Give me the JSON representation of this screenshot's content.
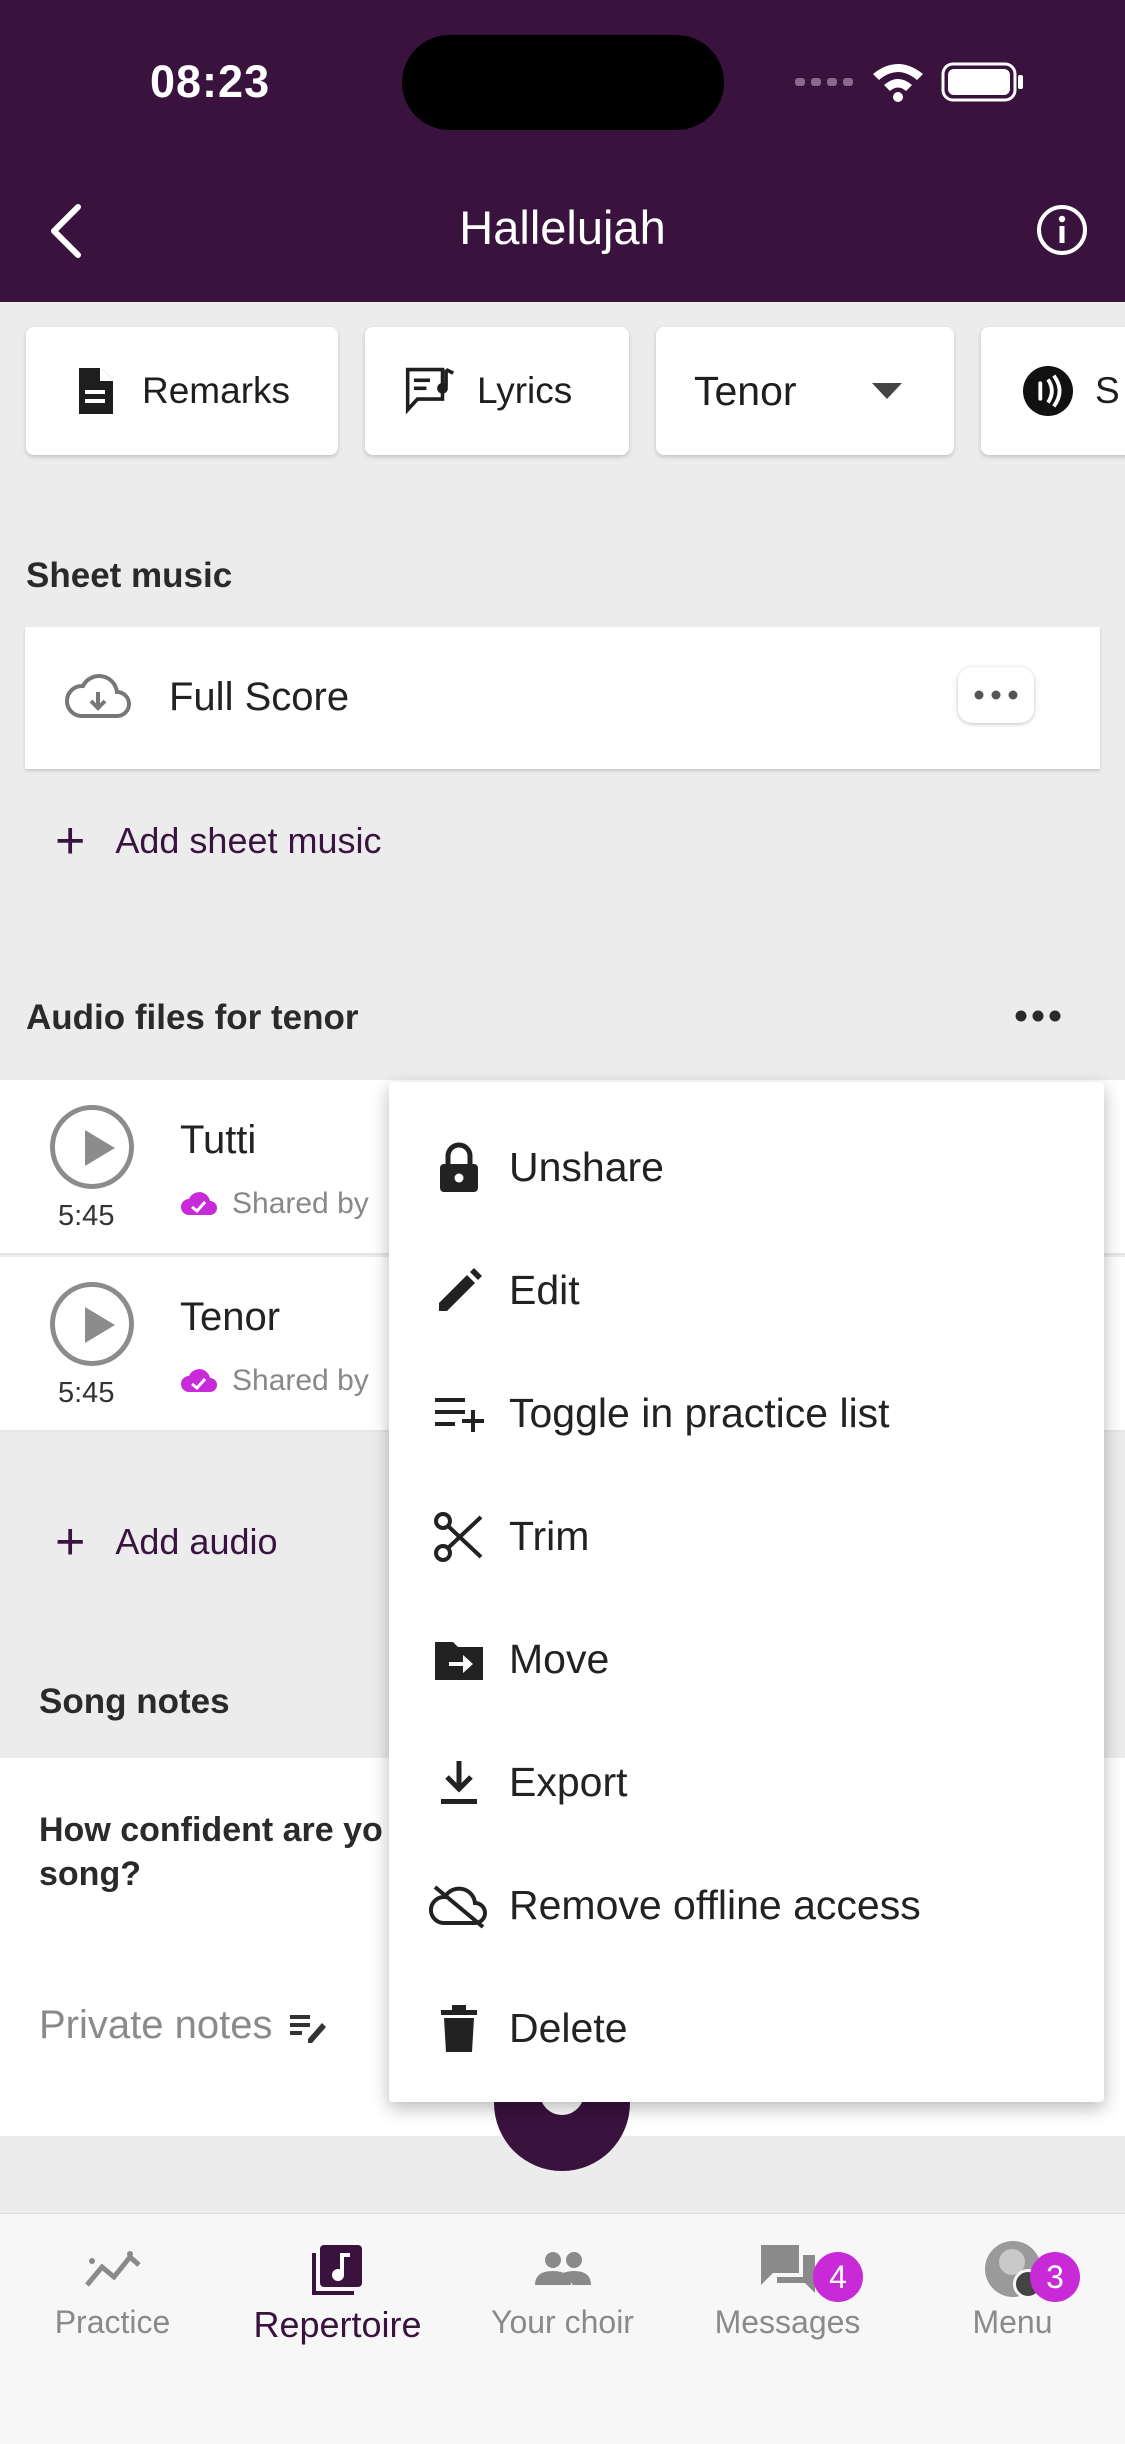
{
  "status_bar": {
    "time": "08:23"
  },
  "header": {
    "title": "Hallelujah",
    "back_icon": "chevron-left-icon",
    "info_icon": "info-icon"
  },
  "chips": {
    "remarks": "Remarks",
    "lyrics": "Lyrics",
    "voice_select": "Tenor",
    "partial": "S"
  },
  "sheet_music": {
    "title": "Sheet music",
    "items": [
      {
        "name": "Full Score"
      }
    ],
    "add_label": "Add sheet music"
  },
  "audio": {
    "title": "Audio files for tenor",
    "tracks": [
      {
        "name": "Tutti",
        "duration": "5:45",
        "shared": "Shared by"
      },
      {
        "name": "Tenor",
        "duration": "5:45",
        "shared": "Shared by"
      }
    ],
    "add_label": "Add audio"
  },
  "song_notes": {
    "title": "Song notes",
    "question": "How confident are yo",
    "question_line2": "song?",
    "private_notes": "Private notes"
  },
  "context_menu": {
    "items": [
      {
        "label": "Unshare",
        "icon": "lock-icon"
      },
      {
        "label": "Edit",
        "icon": "pencil-icon"
      },
      {
        "label": "Toggle in practice list",
        "icon": "playlist-add-icon"
      },
      {
        "label": "Trim",
        "icon": "scissors-icon"
      },
      {
        "label": "Move",
        "icon": "folder-move-icon"
      },
      {
        "label": "Export",
        "icon": "download-icon"
      },
      {
        "label": "Remove offline access",
        "icon": "cloud-off-icon"
      },
      {
        "label": "Delete",
        "icon": "trash-icon"
      }
    ]
  },
  "bottom_nav": {
    "items": [
      {
        "label": "Practice",
        "icon": "chart-line-icon"
      },
      {
        "label": "Repertoire",
        "icon": "music-note-icon",
        "active": true
      },
      {
        "label": "Your choir",
        "icon": "people-icon"
      },
      {
        "label": "Messages",
        "icon": "chat-icon",
        "badge": "4"
      },
      {
        "label": "Menu",
        "icon": "avatar-icon",
        "badge": "3"
      }
    ]
  },
  "colors": {
    "primary": "#39123e",
    "accent": "#c72ad6",
    "background": "#ececec"
  }
}
